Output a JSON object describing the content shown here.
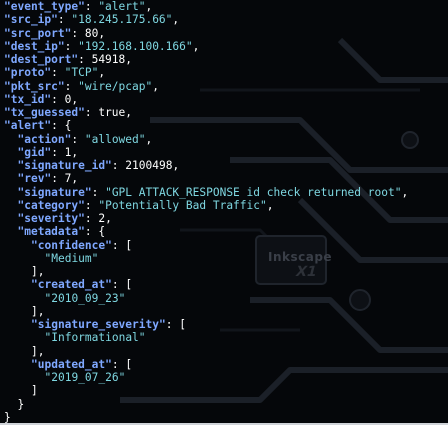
{
  "terminal": {
    "lines": [
      {
        "k": "\"event_type\"",
        "sep": ": ",
        "v": "\"alert\"",
        "tail": ","
      },
      {
        "k": "\"src_ip\"",
        "sep": ": ",
        "v": "\"18.245.175.66\"",
        "tail": ","
      },
      {
        "k": "\"src_port\"",
        "sep": ": ",
        "v": "80",
        "tail": ","
      },
      {
        "k": "\"dest_ip\"",
        "sep": ": ",
        "v": "\"192.168.100.166\"",
        "tail": ","
      },
      {
        "k": "\"dest_port\"",
        "sep": ": ",
        "v": "54918",
        "tail": ","
      },
      {
        "k": "\"proto\"",
        "sep": ": ",
        "v": "\"TCP\"",
        "tail": ","
      },
      {
        "k": "\"pkt_src\"",
        "sep": ": ",
        "v": "\"wire/pcap\"",
        "tail": ","
      },
      {
        "k": "\"tx_id\"",
        "sep": ": ",
        "v": "0",
        "tail": ","
      },
      {
        "k": "\"tx_guessed\"",
        "sep": ": ",
        "v": "true",
        "tail": ","
      },
      {
        "k": "\"alert\"",
        "sep": ": ",
        "v": "{",
        "tail": ""
      },
      {
        "k": "\"action\"",
        "sep": ": ",
        "v": "\"allowed\"",
        "tail": ","
      },
      {
        "k": "\"gid\"",
        "sep": ": ",
        "v": "1",
        "tail": ","
      },
      {
        "k": "\"signature_id\"",
        "sep": ": ",
        "v": "2100498",
        "tail": ","
      },
      {
        "k": "\"rev\"",
        "sep": ": ",
        "v": "7",
        "tail": ","
      },
      {
        "k": "\"signature\"",
        "sep": ": ",
        "v": "\"GPL ATTACK_RESPONSE id check returned root\"",
        "tail": ","
      },
      {
        "k": "\"category\"",
        "sep": ": ",
        "v": "\"Potentially Bad Traffic\"",
        "tail": ","
      },
      {
        "k": "\"severity\"",
        "sep": ": ",
        "v": "2",
        "tail": ","
      },
      {
        "k": "\"metadata\"",
        "sep": ": ",
        "v": "{",
        "tail": ""
      },
      {
        "k": "\"confidence\"",
        "sep": ": ",
        "v": "[",
        "tail": ""
      },
      {
        "k": "",
        "sep": "",
        "v": "\"Medium\"",
        "tail": ""
      },
      {
        "k": "",
        "sep": "",
        "v": "],",
        "tail": ""
      },
      {
        "k": "\"created_at\"",
        "sep": ": ",
        "v": "[",
        "tail": ""
      },
      {
        "k": "",
        "sep": "",
        "v": "\"2010_09_23\"",
        "tail": ""
      },
      {
        "k": "",
        "sep": "",
        "v": "],",
        "tail": ""
      },
      {
        "k": "\"signature_severity\"",
        "sep": ": ",
        "v": "[",
        "tail": ""
      },
      {
        "k": "",
        "sep": "",
        "v": "\"Informational\"",
        "tail": ""
      },
      {
        "k": "",
        "sep": "",
        "v": "],",
        "tail": ""
      },
      {
        "k": "\"updated_at\"",
        "sep": ": ",
        "v": "[",
        "tail": ""
      },
      {
        "k": "",
        "sep": "",
        "v": "\"2019_07_26\"",
        "tail": ""
      },
      {
        "k": "",
        "sep": "",
        "v": "]",
        "tail": ""
      },
      {
        "k": "",
        "sep": "",
        "v": "}",
        "tail": ""
      },
      {
        "k": "",
        "sep": "",
        "v": "}",
        "tail": ""
      }
    ]
  },
  "colors": {
    "key": "#7fa8ff",
    "string": "#7fd8e2",
    "plain": "#ffffff",
    "background": "#000000"
  }
}
